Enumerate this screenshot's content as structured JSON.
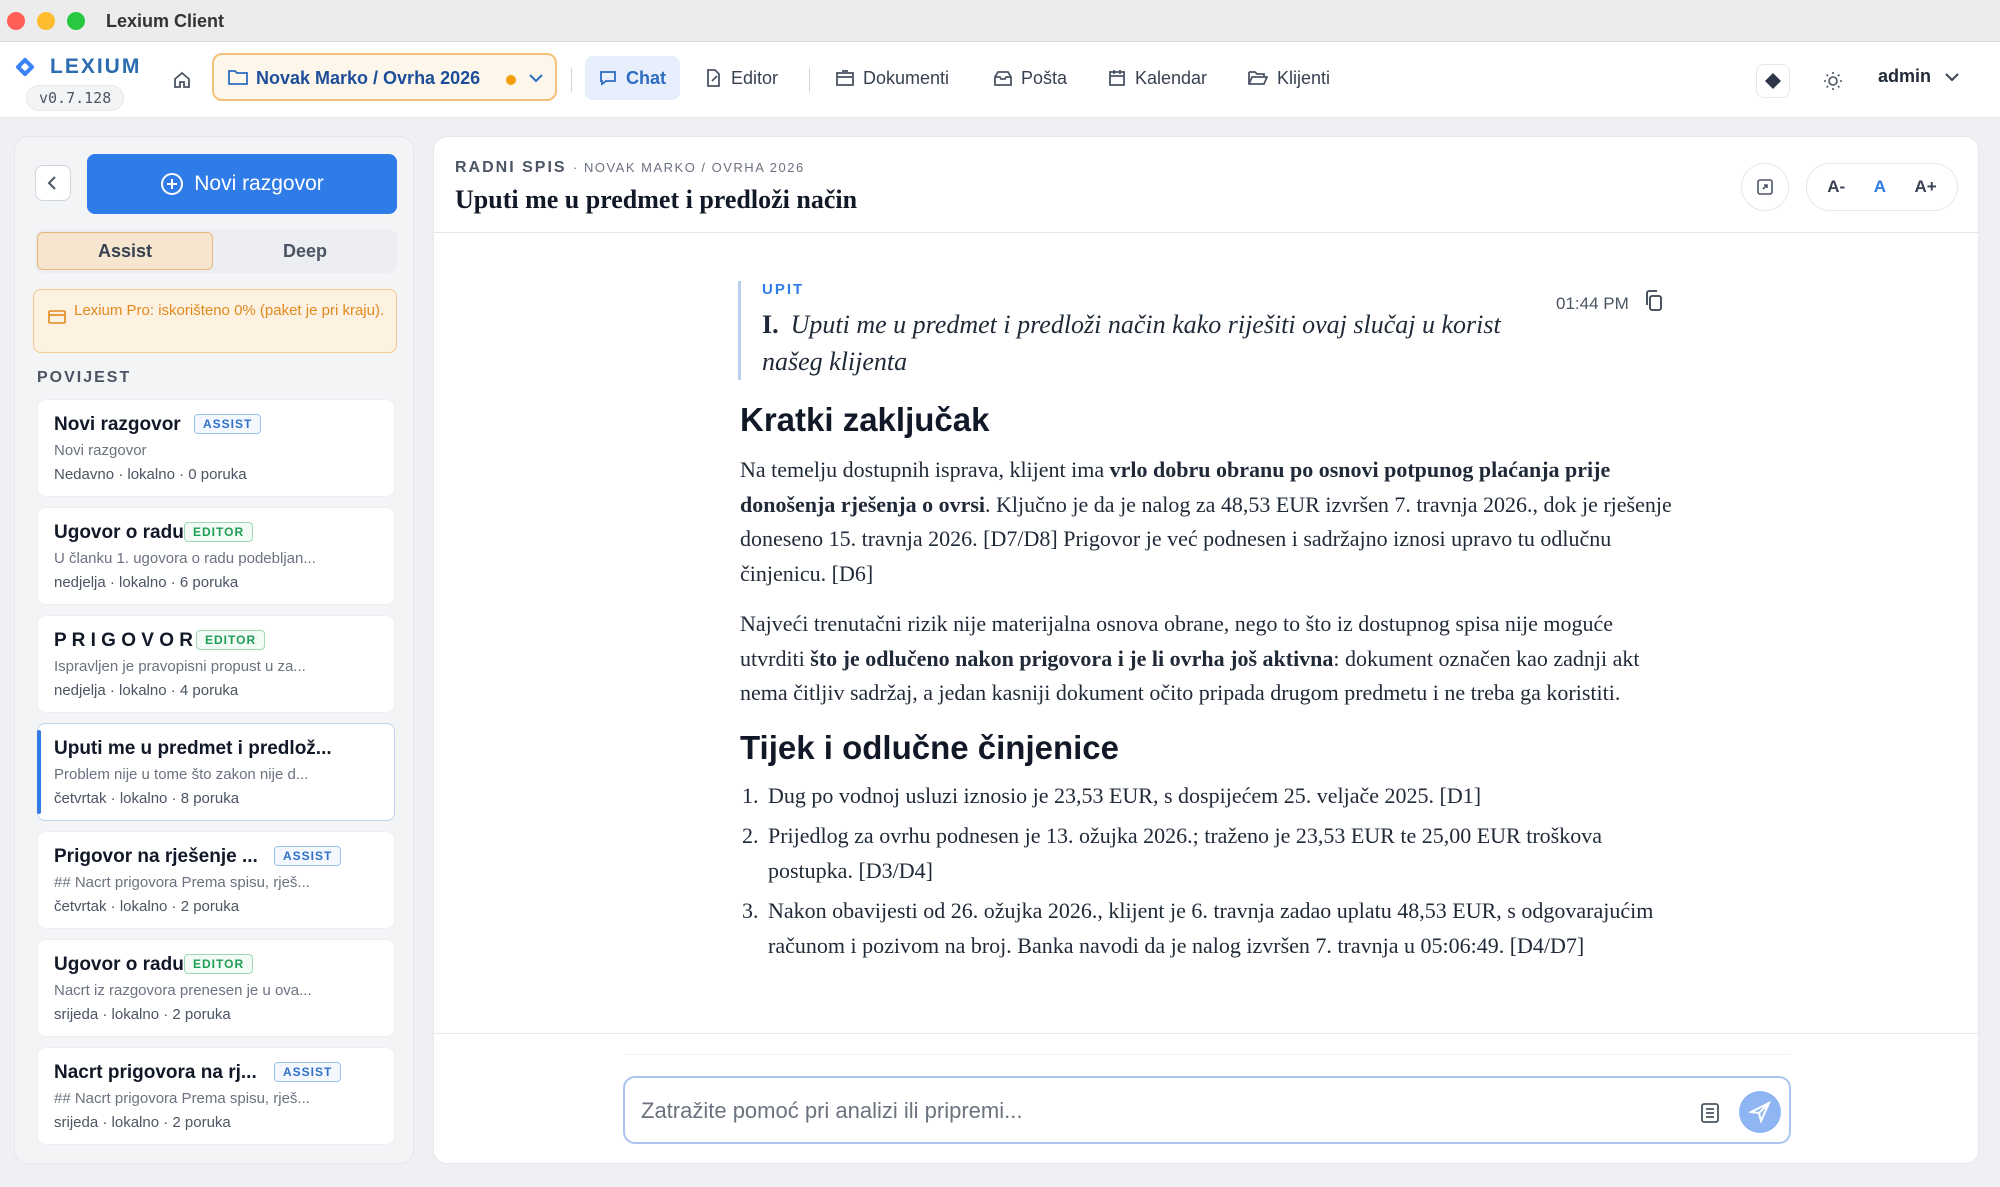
{
  "window": {
    "title": "Lexium Client"
  },
  "brand": {
    "name": "LEXIUM",
    "version": "v0.7.128",
    "accent": "#2f7be8"
  },
  "nav": {
    "case_selector": "Novak Marko / Ovrha 2026",
    "items": [
      {
        "label": "Chat",
        "icon": "chat-icon",
        "active": true
      },
      {
        "label": "Editor",
        "icon": "edit-icon"
      },
      {
        "label": "Dokumenti",
        "icon": "documents-icon"
      },
      {
        "label": "Pošta",
        "icon": "mail-icon"
      },
      {
        "label": "Kalendar",
        "icon": "calendar-icon"
      },
      {
        "label": "Klijenti",
        "icon": "folder-icon"
      }
    ],
    "user": "admin"
  },
  "sidebar": {
    "new_chat": "Novi razgovor",
    "modes": {
      "assist": "Assist",
      "deep": "Deep",
      "selected": "Assist"
    },
    "quota": "Lexium Pro: iskorišteno 0% (paket je pri kraju).",
    "history_label": "POVIJEST",
    "history": [
      {
        "title": "Novi razgovor",
        "badge": "ASSIST",
        "preview": "Novi razgovor",
        "meta": "Nedavno · lokalno · 0 poruka"
      },
      {
        "title": "Ugovor o radu",
        "badge": "EDITOR",
        "preview": "U članku 1. ugovora o radu podebljan...",
        "meta": "nedjelja · lokalno · 6 poruka"
      },
      {
        "title": "P R I G O V O R",
        "badge": "EDITOR",
        "preview": "Ispravljen je pravopisni propust u za...",
        "meta": "nedjelja · lokalno · 4 poruka"
      },
      {
        "title": "Uputi me u predmet i predlož...",
        "badge": "",
        "preview": "Problem nije u tome što zakon nije d...",
        "meta": "četvrtak · lokalno · 8 poruka",
        "selected": true
      },
      {
        "title": "Prigovor na rješenje ...",
        "badge": "ASSIST",
        "preview": "## Nacrt prigovora Prema spisu, rješ...",
        "meta": "četvrtak · lokalno · 2 poruka"
      },
      {
        "title": "Ugovor o radu",
        "badge": "EDITOR",
        "preview": "Nacrt iz razgovora prenesen je u ova...",
        "meta": "srijeda · lokalno · 2 poruka"
      },
      {
        "title": "Nacrt prigovora na rj...",
        "badge": "ASSIST",
        "preview": "## Nacrt prigovora Prema spisu, rješ...",
        "meta": "srijeda · lokalno · 2 poruka"
      }
    ]
  },
  "main": {
    "subtitle": "RADNI SPIS",
    "subtitle_case": "· NOVAK MARKO / OVRHA 2026",
    "title": "Uputi me u predmet i predloži način",
    "font_controls": [
      "A-",
      "A",
      "A+"
    ],
    "query": {
      "label": "UPIT",
      "number": "I.",
      "text": "Uputi me u predmet i predloži način kako riješiti ovaj slučaj u korist našeg klijenta",
      "time": "01:44 PM"
    },
    "answer": {
      "h1": "Kratki zaključak",
      "p1_a": "Na temelju dostupnih isprava, klijent ima ",
      "p1_b": "vrlo dobru obranu po osnovi potpunog plaćanja prije donošenja rješenja o ovrsi",
      "p1_c": ". Ključno je da je nalog za 48,53 EUR izvršen 7. travnja 2026., dok je rješenje doneseno 15. travnja 2026. [D7/D8] Prigovor je već podnesen i sadržajno iznosi upravo tu odlučnu činjenicu. [D6]",
      "p2_a": "Najveći trenutačni rizik nije materijalna osnova obrane, nego to što iz dostupnog spisa nije moguće utvrditi ",
      "p2_b": "što je odlučeno nakon prigovora i je li ovrha još aktivna",
      "p2_c": ": dokument označen kao zadnji akt nema čitljiv sadržaj, a jedan kasniji dokument očito pripada drugom predmetu i ne treba ga koristiti.",
      "h2": "Tijek i odlučne činjenice",
      "list": [
        "Dug po vodnoj usluzi iznosio je 23,53 EUR, s dospijećem 25. veljače 2025. [D1]",
        "Prijedlog za ovrhu podnesen je 13. ožujka 2026.; traženo je 23,53 EUR te 25,00 EUR troškova postupka. [D3/D4]",
        "Nakon obavijesti od 26. ožujka 2026., klijent je 6. travnja zadao uplatu 48,53 EUR, s odgovarajućim računom i pozivom na broj. Banka navodi da je nalog izvršen 7. travnja u 05:06:49. [D4/D7]"
      ]
    },
    "input": {
      "placeholder": "Zatražite pomoć pri analizi ili pripremi...",
      "value": ""
    }
  }
}
